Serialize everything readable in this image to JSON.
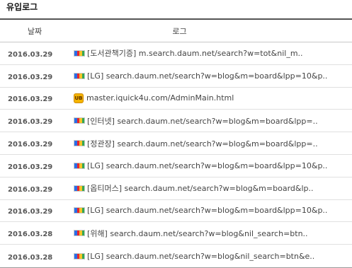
{
  "title": "유입로그",
  "table": {
    "headers": {
      "date": "날짜",
      "log": "로그"
    },
    "rows": [
      {
        "date": "2016.03.29",
        "icon": "daum-favicon-icon",
        "text": "[도서관책기증] m.search.daum.net/search?w=tot&nil_m.."
      },
      {
        "date": "2016.03.29",
        "icon": "daum-favicon-icon",
        "text": "[LG] search.daum.net/search?w=blog&m=board&lpp=10&p.."
      },
      {
        "date": "2016.03.29",
        "icon": "iquick-favicon-icon",
        "icon_text": "UB",
        "text": "master.iquick4u.com/AdminMain.html"
      },
      {
        "date": "2016.03.29",
        "icon": "daum-favicon-icon",
        "text": "[인터넷] search.daum.net/search?w=blog&m=board&lpp=.."
      },
      {
        "date": "2016.03.29",
        "icon": "daum-favicon-icon",
        "text": "[정관장] search.daum.net/search?w=blog&m=board&lpp=.."
      },
      {
        "date": "2016.03.29",
        "icon": "daum-favicon-icon",
        "text": "[LG] search.daum.net/search?w=blog&m=board&lpp=10&p.."
      },
      {
        "date": "2016.03.29",
        "icon": "daum-favicon-icon",
        "text": "[옵티머스] search.daum.net/search?w=blog&m=board&lp.."
      },
      {
        "date": "2016.03.29",
        "icon": "daum-favicon-icon",
        "text": "[LG] search.daum.net/search?w=blog&m=board&lpp=10&p.."
      },
      {
        "date": "2016.03.28",
        "icon": "daum-favicon-icon",
        "text": "[위해] search.daum.net/search?w=blog&nil_search=btn.."
      },
      {
        "date": "2016.03.28",
        "icon": "daum-favicon-icon",
        "text": "[LG] search.daum.net/search?w=blog&nil_search=btn&e.."
      }
    ]
  },
  "colors": {
    "daum_favicon": [
      "#2a6ee8",
      "#e8262d",
      "#f6c327",
      "#34a853"
    ]
  }
}
